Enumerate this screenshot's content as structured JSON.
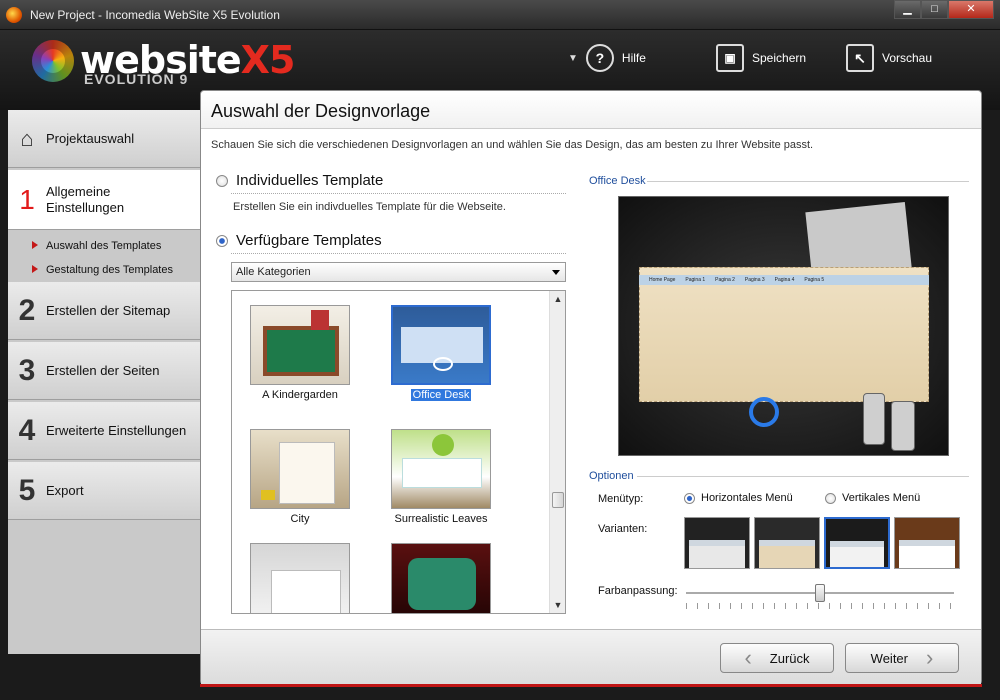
{
  "window": {
    "title": "New Project - Incomedia WebSite X5 Evolution",
    "min": "▁",
    "max": "□",
    "close": "✕"
  },
  "header": {
    "logo_text": "website",
    "logo_x5": "X5",
    "logo_sub": "EVOLUTION 9",
    "buttons": [
      {
        "icon": "help-icon",
        "label": "Hilfe",
        "glyph": "?"
      },
      {
        "icon": "save-icon",
        "label": "Speichern",
        "glyph": "💾"
      },
      {
        "icon": "preview-icon",
        "label": "Vorschau",
        "glyph": "↖"
      }
    ]
  },
  "sidebar": {
    "steps": [
      {
        "num": "",
        "label": "Projektauswahl",
        "icon": "home-icon"
      },
      {
        "num": "1",
        "label": "Allgemeine Einstellungen",
        "active": true
      },
      {
        "num": "2",
        "label": "Erstellen der Sitemap"
      },
      {
        "num": "3",
        "label": "Erstellen der Seiten"
      },
      {
        "num": "4",
        "label": "Erweiterte Einstellungen"
      },
      {
        "num": "5",
        "label": "Export"
      }
    ],
    "substeps": [
      "Auswahl des Templates",
      "Gestaltung des Templates"
    ]
  },
  "main": {
    "title": "Auswahl der Designvorlage",
    "subtitle": "Schauen Sie sich die verschiedenen Designvorlagen an und wählen Sie das Design, das am besten zu Ihrer Website passt.",
    "radio_individual": "Individuelles Template",
    "radio_individual_desc": "Erstellen Sie ein indivduelles Template für die Webseite.",
    "radio_available": "Verfügbare Templates",
    "category_select": "Alle Kategorien",
    "templates": [
      {
        "name": "A Kindergarden"
      },
      {
        "name": "Office Desk",
        "selected": true
      },
      {
        "name": "City"
      },
      {
        "name": "Surrealistic Leaves"
      },
      {
        "name": ""
      },
      {
        "name": ""
      }
    ],
    "preview_title": "Office Desk",
    "preview_nav": [
      "Home Page",
      "Pagina 1",
      "Pagina 2",
      "Pagina 3",
      "Pagina 4",
      "Pagina 5"
    ],
    "options_title": "Optionen",
    "menutyp_label": "Menütyp:",
    "menu_horizontal": "Horizontales Menü",
    "menu_vertical": "Vertikales Menü",
    "varianten_label": "Varianten:",
    "farbanpassung_label": "Farbanpassung:",
    "farbanpassung_value": 0.5,
    "back_button": "Zurück",
    "next_button": "Weiter"
  },
  "colors": {
    "accent": "#2d6bd0",
    "brand_red": "#e42a1f"
  }
}
